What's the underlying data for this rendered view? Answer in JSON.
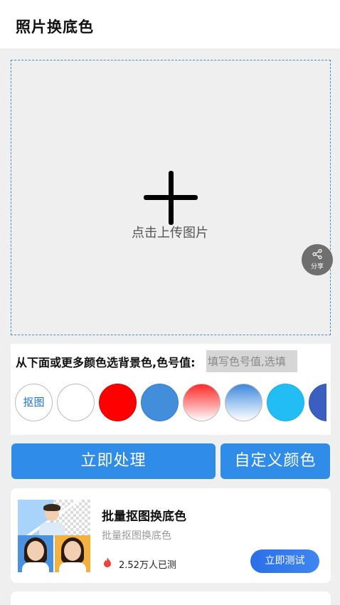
{
  "header": {
    "title": "照片换底色"
  },
  "upload": {
    "label": "点击上传图片"
  },
  "share": {
    "label": "分享",
    "icon": "share-icon"
  },
  "color_panel": {
    "label": "从下面或更多颜色选背景色,色号值:",
    "input_placeholder": "填写色号值,选填",
    "cutout_label": "抠图",
    "swatches": [
      {
        "name": "white",
        "color": "#ffffff"
      },
      {
        "name": "red",
        "color": "#ff0000"
      },
      {
        "name": "blue",
        "color": "#438edb"
      },
      {
        "name": "red-gradient",
        "color": "#ff2a2a"
      },
      {
        "name": "blue-gradient",
        "color": "#3e86dc"
      },
      {
        "name": "sky-blue",
        "color": "#22bdf5"
      },
      {
        "name": "dark-blue",
        "color": "#3b5fc0"
      }
    ]
  },
  "actions": {
    "process_label": "立即处理",
    "custom_color_label": "自定义颜色"
  },
  "promo": {
    "title": "批量抠图换底色",
    "subtitle": "批量抠图换底色",
    "count": "2.52万人已测",
    "test_label": "立即测试"
  }
}
